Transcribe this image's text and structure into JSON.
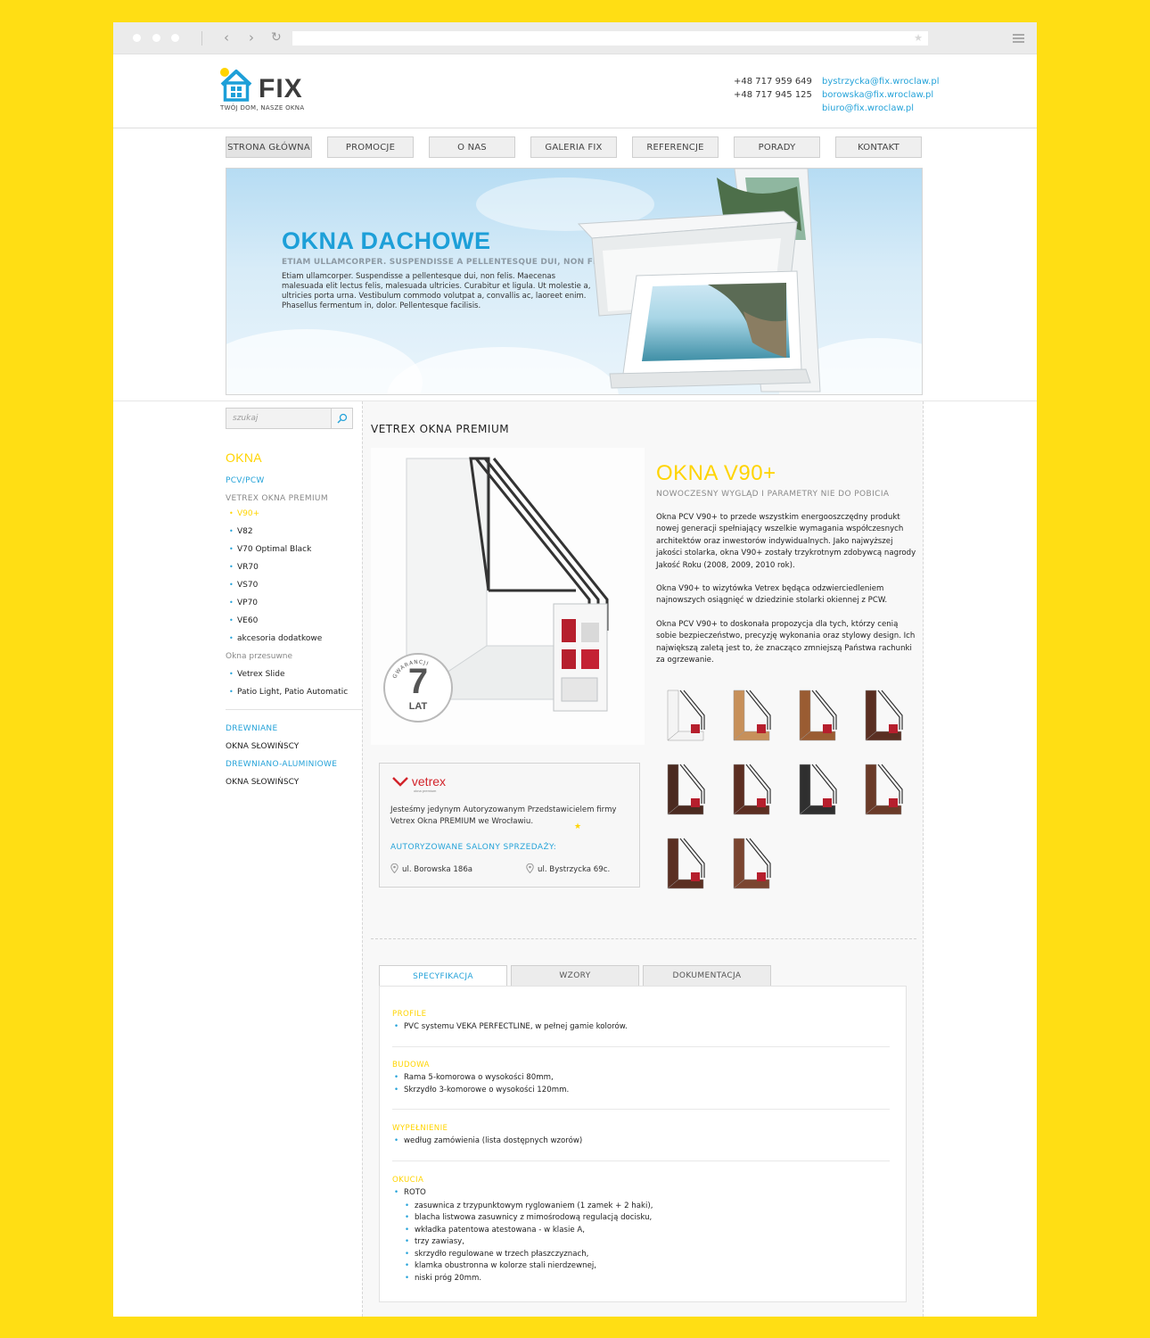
{
  "header": {
    "logo_text": "FIX",
    "logo_tagline": "TWÓJ DOM, NASZE OKNA",
    "phones": [
      "+48 717 959 649",
      "+48 717 945 125"
    ],
    "emails": [
      "bystrzycka@fix.wroclaw.pl",
      "borowska@fix.wroclaw.pl",
      "biuro@fix.wroclaw.pl"
    ]
  },
  "nav": [
    "STRONA GŁÓWNA",
    "PROMOCJE",
    "O NAS",
    "GALERIA FIX",
    "REFERENCJE",
    "PORADY",
    "KONTAKT"
  ],
  "banner": {
    "title": "OKNA DACHOWE",
    "subtitle": "ETIAM ULLAMCORPER. SUSPENDISSE A PELLENTESQUE DUI, NON FELIS.",
    "text": "Etiam ullamcorper. Suspendisse a pellentesque dui, non felis. Maecenas malesuada elit lectus felis, malesuada ultricies. Curabitur et ligula. Ut molestie a, ultricies porta urna. Vestibulum commodo volutpat a, convallis ac, laoreet enim. Phasellus fermentum in, dolor. Pellentesque facilisis."
  },
  "sidebar": {
    "search_placeholder": "szukaj",
    "heading": "OKNA",
    "sub1": "PCV/PCW",
    "sub2": "VETREX OKNA PREMIUM",
    "items": [
      "V90+",
      "V82",
      "V70 Optimal Black",
      "VR70",
      "VS70",
      "VP70",
      "VE60",
      "akcesoria dodatkowe"
    ],
    "sliding_label": "Okna przesuwne",
    "sliding_items": [
      "Vetrex Slide",
      "Patio Light, Patio Automatic"
    ],
    "cat1": "DREWNIANE",
    "link1": "OKNA SŁOWIŃSCY",
    "cat2": "DREWNIANO-ALUMINIOWE",
    "link2": "OKNA SŁOWIŃSCY"
  },
  "content": {
    "title": "VETREX OKNA PREMIUM",
    "badge_number": "7",
    "badge_unit": "LAT",
    "badge_ring": "GWARANCJI",
    "product_heading": "OKNA V90+",
    "product_subheading": "NOWOCZESNY WYGLĄD I PARAMETRY NIE DO POBICIA",
    "desc": [
      "Okna PCV V90+ to przede wszystkim energooszczędny produkt nowej generacji spełniający wszelkie wymagania współczesnych architektów oraz inwestorów indywidualnych. Jako najwyższej jakości stolarka, okna V90+ zostały trzykrotnym zdobywcą nagrody Jakość Roku (2008, 2009, 2010 rok).",
      "Okna V90+ to wizytówka Vetrex będąca odzwierciedleniem najnowszych osiągnięć w dziedzinie stolarki okiennej z PCW.",
      "Okna PCV V90+ to doskonała propozycja dla tych, którzy cenią sobie bezpieczeństwo, precyzję wykonania oraz stylowy design. Ich największą zaletą jest to, że znacząco zmniejszą Państwa rachunki za ogrzewanie."
    ],
    "swatch_colors": [
      "#f4f4f4",
      "#c7905a",
      "#9a5c32",
      "#5a2f22",
      "#4b2a20",
      "#5c2e22",
      "#2f2f2f",
      "#6a3a28",
      "#5a2f22",
      "#7a4530"
    ],
    "vetrex": {
      "logo": "vetrex",
      "logo_small": "okna premium",
      "text": "Jesteśmy jedynym Autoryzowanym Przedstawicielem firmy Vetrex Okna PREMIUM we Wrocławiu.",
      "salons_label": "AUTORYZOWANE SALONY SPRZEDAŻY:",
      "addr1": "ul. Borowska 186a",
      "addr2": "ul. Bystrzycka 69c."
    },
    "tabs": [
      "SPECYFIKACJA",
      "WZORY",
      "DOKUMENTACJA"
    ],
    "spec": {
      "profile_h": "PROFILE",
      "profile": [
        "PVC systemu VEKA PERFECTLINE, w pełnej gamie kolorów."
      ],
      "budowa_h": "BUDOWA",
      "budowa": [
        "Rama 5-komorowa o wysokości 80mm,",
        "Skrzydło 3-komorowe o wysokości 120mm."
      ],
      "wyp_h": "WYPEŁNIENIE",
      "wyp": [
        "według zamówienia (lista dostępnych wzorów)"
      ],
      "okucia_h": "OKUCIA",
      "okucia": [
        "ROTO"
      ],
      "okucia_sub": [
        "zasuwnica z trzypunktowym ryglowaniem (1 zamek + 2 haki),",
        "blacha listwowa zasuwnicy z mimośrodową regulacją docisku,",
        "wkładka patentowa atestowana - w klasie A,",
        "trzy zawiasy,",
        "skrzydło regulowane w trzech płaszczyznach,",
        "klamka obustronna w kolorze stali nierdzewnej,",
        "niski próg 20mm."
      ]
    }
  }
}
